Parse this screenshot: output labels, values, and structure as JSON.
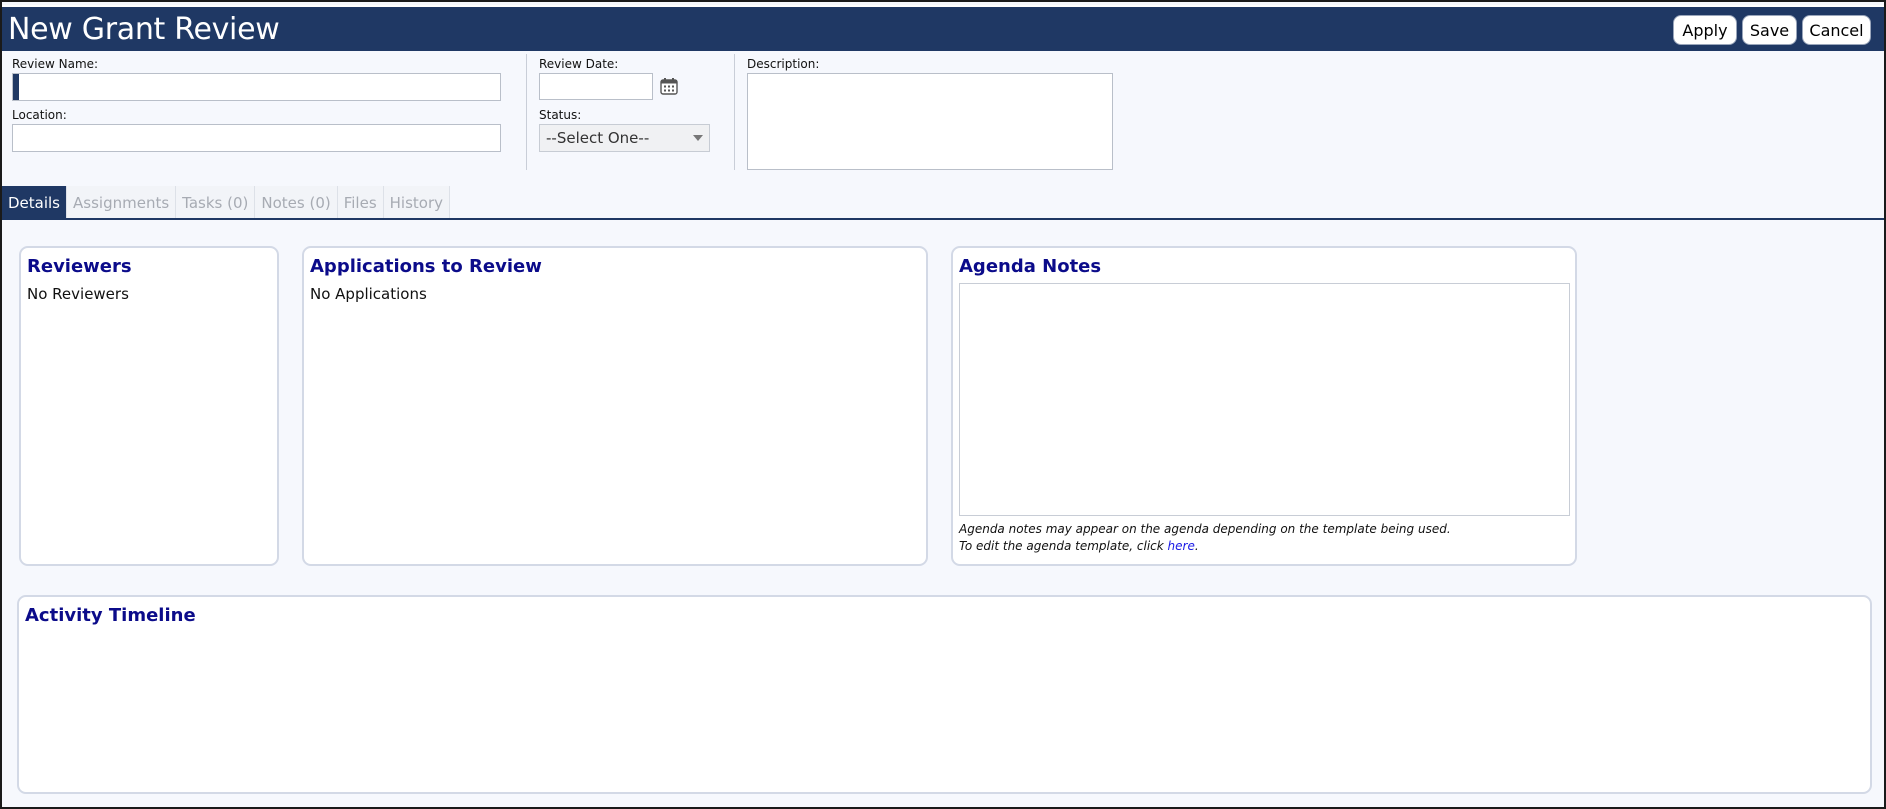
{
  "header": {
    "title": "New Grant Review",
    "buttons": {
      "apply": "Apply",
      "save": "Save",
      "cancel": "Cancel"
    }
  },
  "form": {
    "review_name_label": "Review Name:",
    "review_name_value": "",
    "location_label": "Location:",
    "location_value": "",
    "review_date_label": "Review Date:",
    "review_date_value": "",
    "status_label": "Status:",
    "status_selected": "--Select One--",
    "description_label": "Description:",
    "description_value": ""
  },
  "tabs": [
    {
      "label": "Details"
    },
    {
      "label": "Assignments"
    },
    {
      "label": "Tasks (0)"
    },
    {
      "label": "Notes (0)"
    },
    {
      "label": "Files"
    },
    {
      "label": "History"
    }
  ],
  "panels": {
    "reviewers": {
      "title": "Reviewers",
      "empty_text": "No Reviewers"
    },
    "applications": {
      "title": "Applications to Review",
      "empty_text": "No Applications"
    },
    "agenda": {
      "title": "Agenda Notes",
      "note_line1": "Agenda notes may appear on the agenda depending on the template being used.",
      "note_line2_prefix": "To edit the agenda template, click ",
      "note_link": "here",
      "note_line2_suffix": "."
    },
    "timeline": {
      "title": "Activity Timeline"
    }
  },
  "colors": {
    "header_bg": "#1f3864",
    "panel_title": "#0b0b8a",
    "link": "#1a1ae6",
    "active_tab": "#1f3864"
  },
  "icons": {
    "date_picker": "calendar-icon",
    "status_dropdown": "chevron-down-icon"
  }
}
